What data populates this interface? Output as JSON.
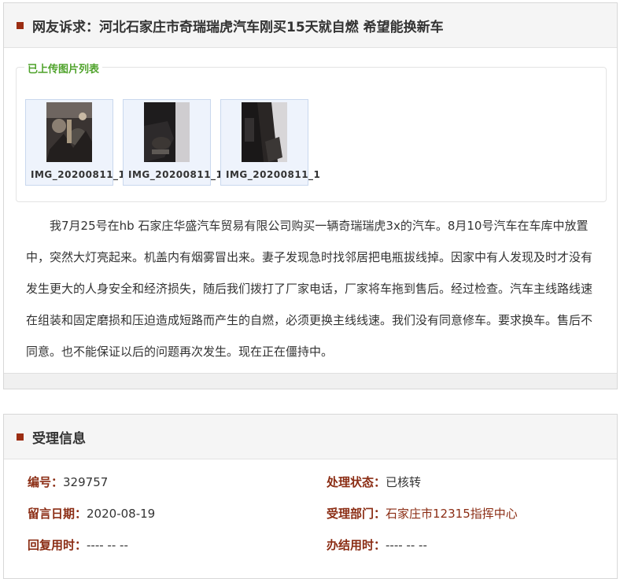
{
  "complaint": {
    "title": "网友诉求：河北石家庄市奇瑞瑞虎汽车刚买15天就自燃 希望能换新车",
    "images_legend": "已上传图片列表",
    "images": [
      {
        "name": "IMG_20200811_1"
      },
      {
        "name": "IMG_20200811_1"
      },
      {
        "name": "IMG_20200811_1"
      }
    ],
    "body": "我7月25号在hb 石家庄华盛汽车贸易有限公司购买一辆奇瑞瑞虎3x的汽车。8月10号汽车在车库中放置中，突然大灯亮起来。机盖内有烟雾冒出来。妻子发现急时找邻居把电瓶拔线掉。因家中有人发现及时才没有发生更大的人身安全和经济损失，随后我们拨打了厂家电话，厂家将车拖到售后。经过检查。汽车主线路线速在组装和固定磨损和压迫造成短路而产生的自燃，必须更换主线线速。我们没有同意修车。要求换车。售后不同意。也不能保证以后的问题再次发生。现在正在僵持中。"
  },
  "acceptance": {
    "title": "受理信息",
    "number_label": "编号：",
    "number": "329757",
    "status_label": "处理状态：",
    "status": "已核转",
    "date_label": "留言日期：",
    "date": "2020-08-19",
    "dept_label": "受理部门：",
    "dept": "石家庄市12315指挥中心",
    "reply_label": "回复用时：",
    "reply": "---- -- --",
    "done_label": "办结用时：",
    "done": "---- -- --"
  },
  "colors": {
    "accent": "#9b2d12",
    "legend": "#4fa32b",
    "label": "#8b2d14"
  }
}
